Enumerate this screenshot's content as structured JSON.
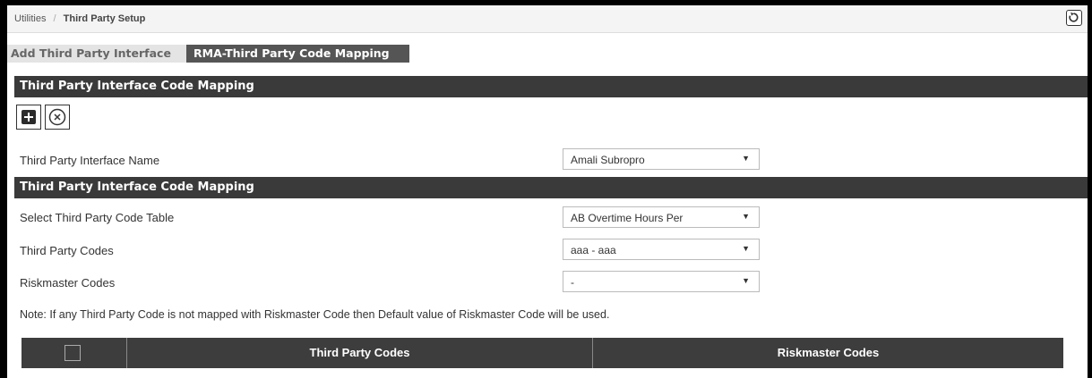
{
  "breadcrumb": {
    "root": "Utilities",
    "separator": "/",
    "current": "Third Party Setup"
  },
  "tabs": [
    {
      "label": "Add Third Party Interface",
      "active": false
    },
    {
      "label": "RMA-Third Party Code Mapping",
      "active": true
    }
  ],
  "section1": {
    "title": "Third Party Interface Code Mapping"
  },
  "toolbar": {
    "add_icon": "plus-square-icon",
    "cancel_icon": "circle-x-icon"
  },
  "interface": {
    "label": "Third Party Interface Name",
    "value": "Amali Subropro"
  },
  "section2": {
    "title": "Third Party Interface Code Mapping"
  },
  "fields": [
    {
      "label": "Select Third Party Code Table",
      "value": "AB Overtime Hours Per"
    },
    {
      "label": "Third Party Codes",
      "value": "aaa - aaa"
    },
    {
      "label": "Riskmaster Codes",
      "value": "-"
    }
  ],
  "note": "Note: If any Third Party Code is not mapped with Riskmaster Code then Default value of Riskmaster Code will be used.",
  "grid": {
    "columns": [
      "Third Party Codes",
      "Riskmaster Codes"
    ]
  },
  "colors": {
    "header_dark": "#3a3a3a",
    "tab_active": "#555555",
    "tab_inactive": "#e4e4e4"
  }
}
